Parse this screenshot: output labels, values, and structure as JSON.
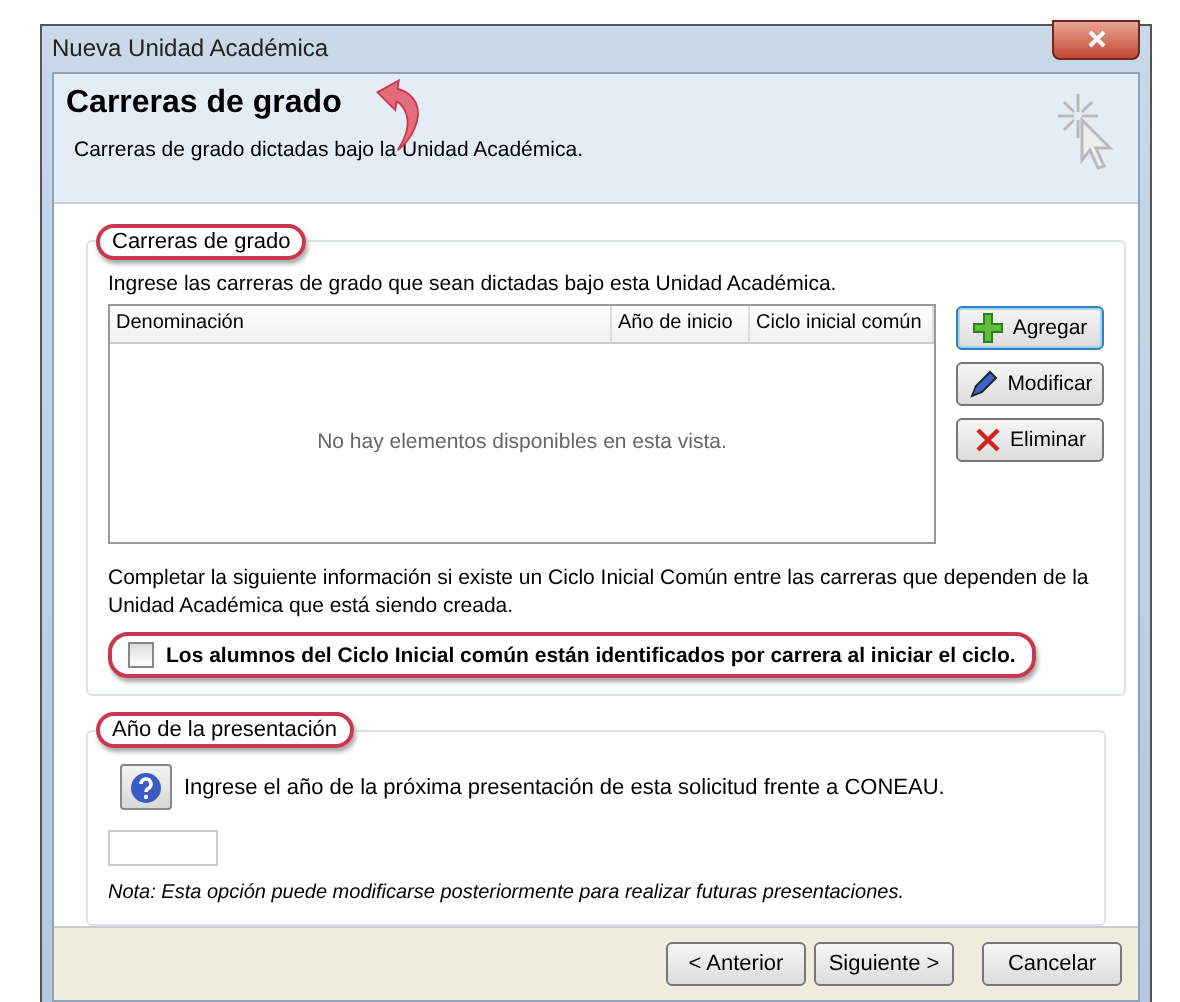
{
  "window": {
    "title": "Nueva Unidad Académica"
  },
  "header": {
    "title": "Carreras de grado",
    "subtitle": "Carreras de grado dictadas bajo la Unidad Académica.",
    "annotation_arrow": true
  },
  "careers_section": {
    "title": "Carreras de grado",
    "highlighted": true,
    "instructions": "Ingrese las carreras de grado que sean dictadas bajo esta Unidad Académica.",
    "table": {
      "columns": [
        "Denominación",
        "Año de inicio",
        "Ciclo inicial común"
      ],
      "empty_message": "No hay elementos disponibles en esta vista."
    },
    "buttons": [
      {
        "label": "Agregar",
        "kind": "add",
        "focused": true
      },
      {
        "label": "Modificar",
        "kind": "edit",
        "focused": false
      },
      {
        "label": "Eliminar",
        "kind": "delete",
        "focused": false
      }
    ],
    "info": "Completar la siguiente información si existe un Ciclo Inicial Común entre las carreras que dependen de la Unidad Académica que está siendo creada.",
    "checkbox": {
      "label": "Los alumnos del Ciclo Inicial común están identificados por carrera al iniciar el ciclo.",
      "checked": false,
      "highlighted": true
    }
  },
  "year_section": {
    "title": "Año de la presentación",
    "highlighted": true,
    "instructions": "Ingrese el año de la próxima presentación de esta solicitud frente a CONEAU.",
    "note": "Nota: Esta opción puede modificarse posteriormente para realizar futuras presentaciones."
  },
  "footer_buttons": [
    {
      "label": "< Anterior"
    },
    {
      "label": "Siguiente >"
    },
    {
      "label": "Cancelar"
    }
  ]
}
